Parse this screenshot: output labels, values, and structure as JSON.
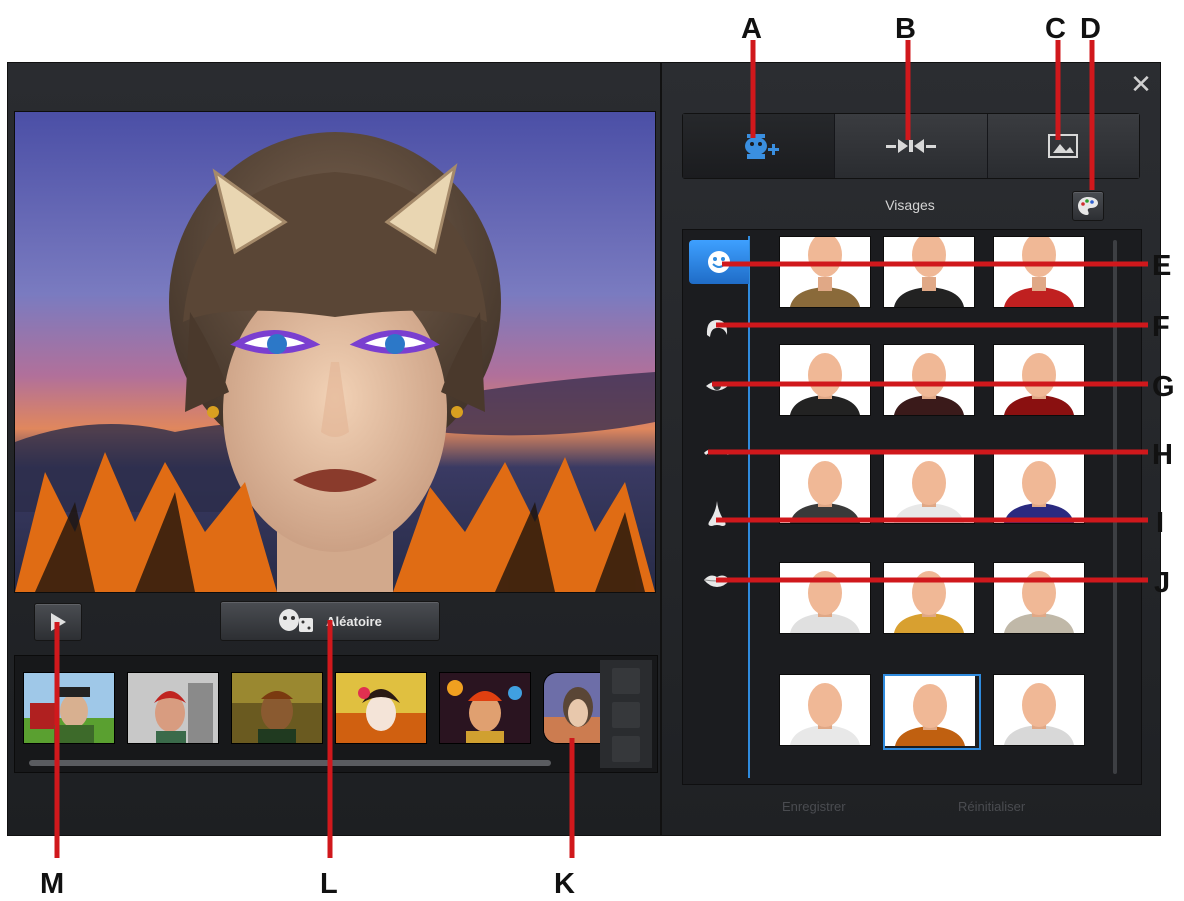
{
  "main": {
    "random_button": {
      "label": "Aléatoire",
      "icon": "masks-dice-icon"
    },
    "play_button": {
      "icon": "play-icon"
    }
  },
  "thumbnails": {
    "items": [
      {
        "name": "avatar-farmer-hat"
      },
      {
        "name": "avatar-red-hair-city"
      },
      {
        "name": "avatar-dark-skin-autumn"
      },
      {
        "name": "avatar-geisha"
      },
      {
        "name": "avatar-clown-fireworks"
      },
      {
        "name": "avatar-current-cat-ears"
      }
    ]
  },
  "panel": {
    "tabs": [
      {
        "icon": "add-face-icon",
        "active": true
      },
      {
        "icon": "morph-icon",
        "active": false
      },
      {
        "icon": "background-image-icon",
        "active": false
      }
    ],
    "section_title": "Visages",
    "palette_icon": "palette-icon",
    "categories": [
      {
        "icon": "face-icon",
        "active": true
      },
      {
        "icon": "hair-icon"
      },
      {
        "icon": "eye-icon"
      },
      {
        "icon": "eyebrow-icon"
      },
      {
        "icon": "nose-icon"
      },
      {
        "icon": "lips-icon"
      }
    ],
    "save_label": "Enregistrer",
    "reset_label": "Réinitialiser"
  },
  "callouts": {
    "A": "A",
    "B": "B",
    "C": "C",
    "D": "D",
    "E": "E",
    "F": "F",
    "G": "G",
    "H": "H",
    "I": "I",
    "J": "J",
    "K": "K",
    "L": "L",
    "M": "M"
  },
  "colors": {
    "accent": "#2f8bde",
    "callout_line": "#d0181c"
  }
}
